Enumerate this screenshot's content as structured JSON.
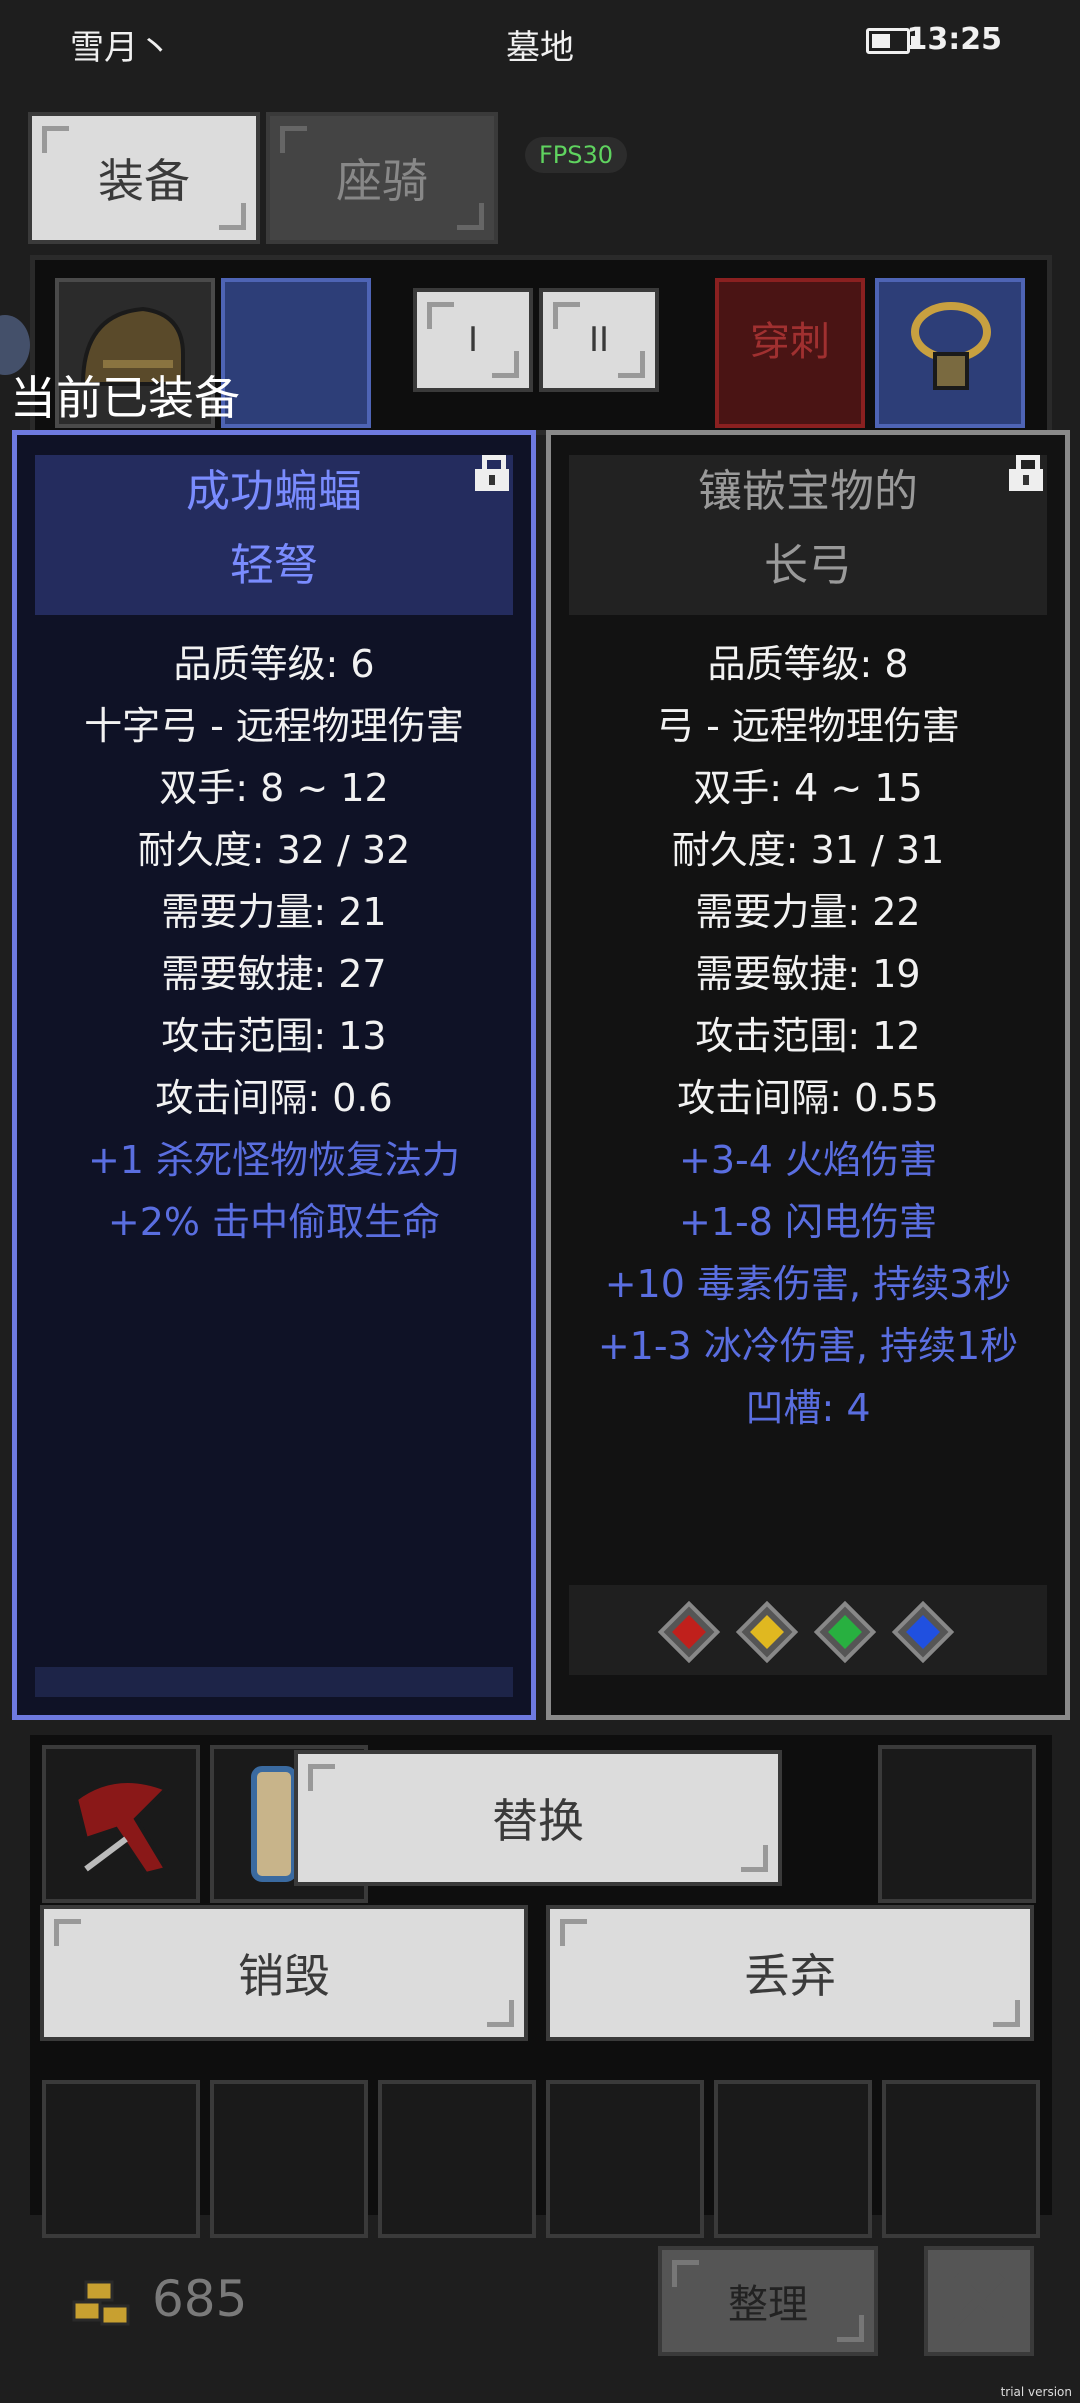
{
  "status_bar": {
    "left": "雪月丶",
    "center": "墓地",
    "time": "13:25"
  },
  "tabs": [
    {
      "label": "装备"
    },
    {
      "label": "座骑"
    }
  ],
  "fps": "FPS30",
  "strip": {
    "roman_1": "I",
    "roman_2": "II",
    "red_slot_text": "穿刺"
  },
  "equipped_label": "当前已装备",
  "left_item": {
    "title_line1": "成功蝙蝠",
    "title_line2": "轻弩",
    "stats": [
      "品质等级: 6",
      "十字弓 - 远程物理伤害",
      "双手: 8 ~ 12",
      "耐久度: 32 / 32",
      "需要力量: 21",
      "需要敏捷: 27",
      "攻击范围: 13",
      "攻击间隔: 0.6"
    ],
    "mods": [
      "+1 杀死怪物恢复法力",
      "+2% 击中偷取生命"
    ]
  },
  "right_item": {
    "title_line1": "镶嵌宝物的",
    "title_line2": "长弓",
    "stats": [
      "品质等级: 8",
      "弓 - 远程物理伤害",
      "双手: 4 ~ 15",
      "耐久度: 31 / 31",
      "需要力量: 22",
      "需要敏捷: 19",
      "攻击范围: 12",
      "攻击间隔: 0.55"
    ],
    "mods": [
      "+3-4 火焰伤害",
      "+1-8 闪电伤害",
      "+10 毒素伤害, 持续3秒",
      "+1-3 冰冷伤害, 持续1秒",
      "凹槽: 4"
    ],
    "gems": [
      "red-gem-icon",
      "yellow-gem-icon",
      "green-gem-icon",
      "blue-gem-icon"
    ]
  },
  "actions": {
    "replace": "替换",
    "destroy": "销毁",
    "drop": "丢弃"
  },
  "footer": {
    "gold": "685",
    "sort": "整理"
  },
  "watermark": "trial version"
}
